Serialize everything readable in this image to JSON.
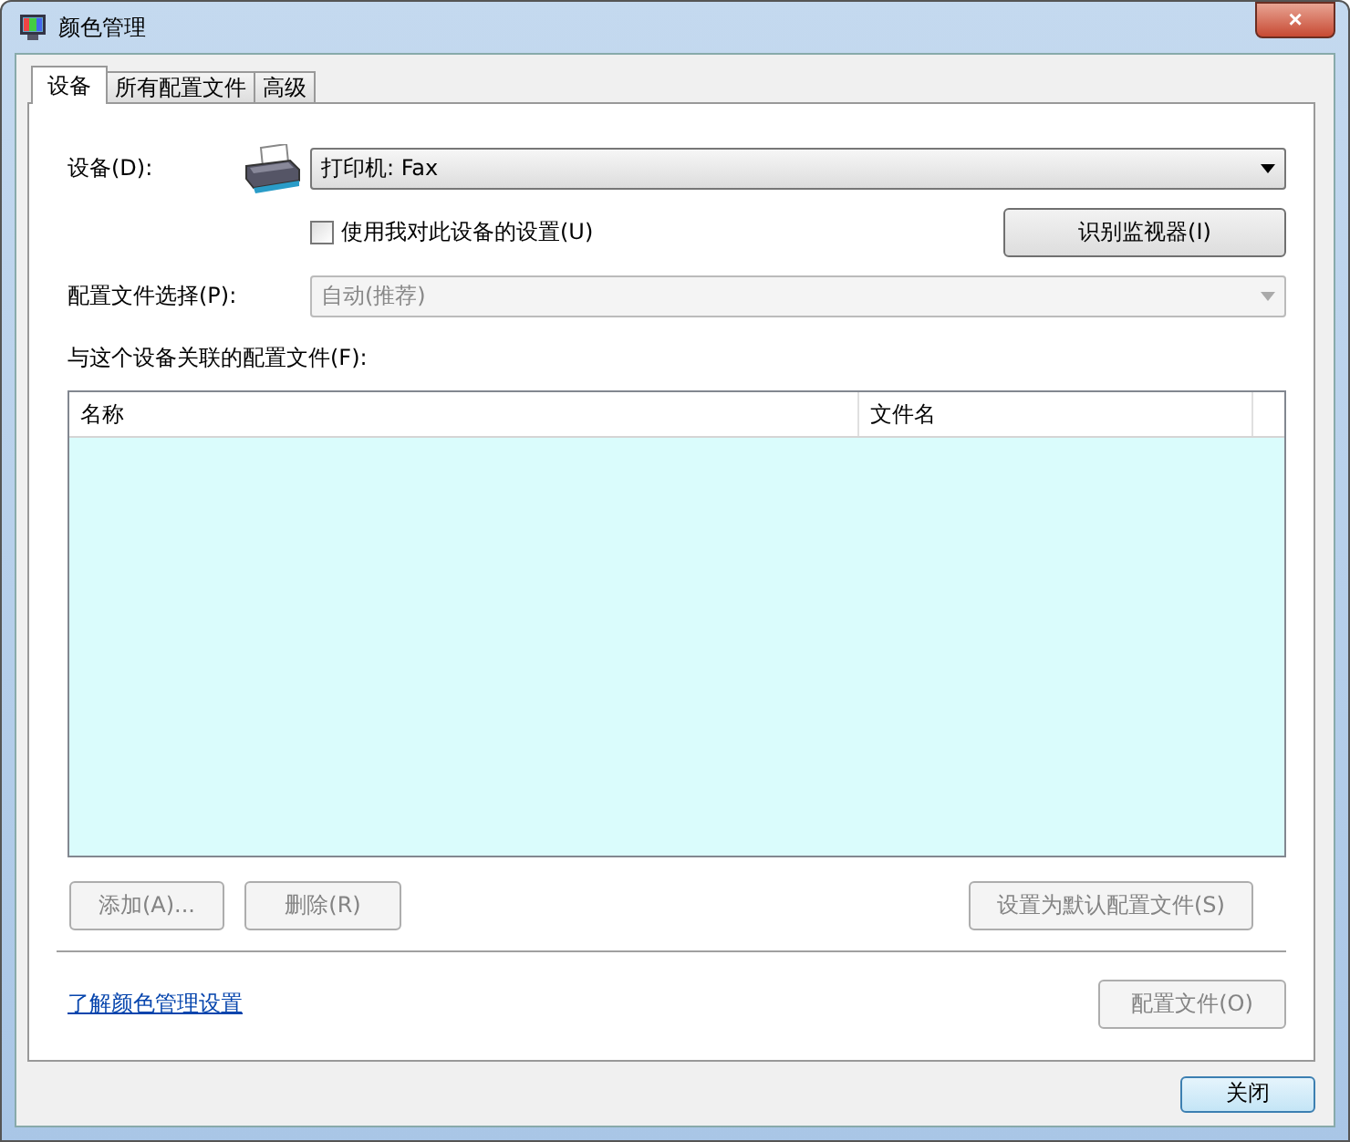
{
  "window": {
    "title": "颜色管理",
    "close": "×"
  },
  "tabs": [
    {
      "label": "设备",
      "selected": true
    },
    {
      "label": "所有配置文件",
      "selected": false
    },
    {
      "label": "高级",
      "selected": false
    }
  ],
  "device": {
    "label": "设备(D):",
    "value": "打印机: Fax",
    "disabled": false
  },
  "use_settings": {
    "label": "使用我对此设备的设置(U)",
    "checked": false
  },
  "identify_button": {
    "label": "识别监视器(I)",
    "disabled": false
  },
  "profile_selection": {
    "label": "配置文件选择(P):",
    "value": "自动(推荐)",
    "disabled": true
  },
  "associated_label": "与这个设备关联的配置文件(F):",
  "table": {
    "columns": [
      "名称",
      "文件名"
    ]
  },
  "list_buttons": [
    {
      "label": "添加(A)...",
      "disabled": true
    },
    {
      "label": "删除(R)",
      "disabled": true
    },
    {
      "label": "设置为默认配置文件(S)",
      "disabled": true
    }
  ],
  "link": "了解颜色管理设置",
  "profiles_button": {
    "label": "配置文件(O)",
    "disabled": true
  },
  "close_button": {
    "label": "关闭",
    "disabled": false
  }
}
